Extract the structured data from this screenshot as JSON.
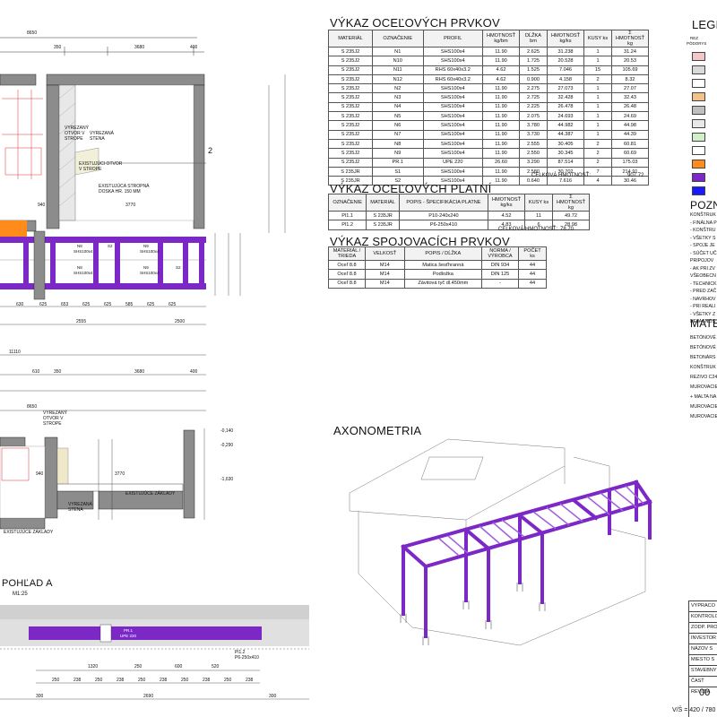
{
  "titles": {
    "steel_elements": "VÝKAZ OCEĽOVÝCH PRVKOV",
    "steel_plates": "VÝKAZ OCEĽOVÝCH PLATNÍ",
    "connectors": "VÝKAZ SPOJOVACÍCH PRVKOV",
    "axonometry": "AXONOMETRIA",
    "view_a": "POHĽAD A",
    "view_a_scale": "M1:25",
    "legend": "LEGE",
    "notes": "POZN",
    "materials": "MATE"
  },
  "steel_table": {
    "headers": [
      "MATERIÁL",
      "OZNAČENIE",
      "PROFIL",
      "HMOTNOSŤ kg/bm",
      "DĹŽKA bm",
      "HMOTNOSŤ kg/ks",
      "KUSY ks",
      "Σ HMOTNOSŤ kg"
    ],
    "rows": [
      [
        "S 235J2",
        "N1",
        "SHS100x4",
        "11.90",
        "2.625",
        "31.238",
        "1",
        "31.24"
      ],
      [
        "S 235J2",
        "N10",
        "SHS100x4",
        "11.90",
        "1.725",
        "20.528",
        "1",
        "20.53"
      ],
      [
        "S 235J2",
        "N11",
        "RHS 60x40x3.2",
        "4.62",
        "1.525",
        "7.046",
        "15",
        "105.69"
      ],
      [
        "S 235J2",
        "N12",
        "RHS 60x40x3.2",
        "4.62",
        "0.900",
        "4.158",
        "2",
        "8.32"
      ],
      [
        "S 235J2",
        "N2",
        "SHS100x4",
        "11.90",
        "2.275",
        "27.073",
        "1",
        "27.07"
      ],
      [
        "S 235J2",
        "N3",
        "SHS100x4",
        "11.90",
        "2.725",
        "32.428",
        "1",
        "32.43"
      ],
      [
        "S 235J2",
        "N4",
        "SHS100x4",
        "11.90",
        "2.225",
        "26.478",
        "1",
        "26.48"
      ],
      [
        "S 235J2",
        "N5",
        "SHS100x4",
        "11.90",
        "2.075",
        "24.693",
        "1",
        "24.69"
      ],
      [
        "S 235J2",
        "N6",
        "SHS100x4",
        "11.90",
        "3.780",
        "44.982",
        "1",
        "44.98"
      ],
      [
        "S 235J2",
        "N7",
        "SHS100x4",
        "11.90",
        "3.730",
        "44.387",
        "1",
        "44.39"
      ],
      [
        "S 235J2",
        "N8",
        "SHS100x4",
        "11.90",
        "2.555",
        "30.405",
        "2",
        "60.81"
      ],
      [
        "S 235J2",
        "N9",
        "SHS100x4",
        "11.90",
        "2.550",
        "30.345",
        "2",
        "60.69"
      ],
      [
        "S 235J2",
        "PR.1",
        "UPE 220",
        "26.60",
        "3.290",
        "87.514",
        "2",
        "175.03"
      ],
      [
        "S 235JR",
        "S1",
        "SHS100x4",
        "11.90",
        "2.580",
        "30.702",
        "7",
        "214.91"
      ],
      [
        "S 235JR",
        "S2",
        "SHS100x4",
        "11.90",
        "0.640",
        "7.616",
        "4",
        "30.46"
      ]
    ],
    "total_label": "CELKOVÁ HMOTNOSŤ:",
    "total_value": "907.72"
  },
  "plates_table": {
    "headers": [
      "OZNAČENIE",
      "MATERIÁL",
      "POPIS - ŠPECIFIKÁCIA PLATNE",
      "HMOTNOSŤ kg/ks",
      "KUSY ks",
      "Σ HMOTNOSŤ kg"
    ],
    "rows": [
      [
        "Pl1.1",
        "S 235JR",
        "P10-240x240",
        "4.52",
        "11",
        "49.72"
      ],
      [
        "Pl1.2",
        "S 235JR",
        "P6-250x410",
        "4.83",
        "6",
        "28.98"
      ]
    ],
    "total_label": "CELKOVÁ HMOTNOSŤ:",
    "total_value": "78.70"
  },
  "connectors_table": {
    "headers": [
      "MATERIÁL / TRIEDA",
      "VELKOSŤ",
      "POPIS / DĹŽKA",
      "NORMA / VÝROBCA",
      "POČET ks"
    ],
    "rows": [
      [
        "Oceľ 8.8",
        "M14",
        "Matica šesťhranná",
        "DIN 934",
        "44"
      ],
      [
        "Oceľ 8.8",
        "M14",
        "Podložka",
        "DIN 125",
        "44"
      ],
      [
        "Oceľ 8.8",
        "M14",
        "Závitová tyč dl.450mm",
        "-",
        "44"
      ]
    ]
  },
  "legend": {
    "col_headers": [
      "REZ",
      "PÔDORYS"
    ],
    "swatch_colors": [
      "#f4c6c6",
      "#d9d9d9",
      "#ffffff",
      "#f2c28a",
      "#bfbfbf",
      "#e8e8e8",
      "#d0f0c8",
      "#ffffff",
      "#ff8c1a",
      "#7b28c6",
      "#1a1aff"
    ]
  },
  "notes": {
    "items": [
      "KONŠTRUK",
      "- FINÁLNA P",
      "- KONŠTRU",
      "- VŠETKY S",
      "- SPOJE JE",
      "- SÚČET UČ",
      "PRIPOJOV",
      "- AK PRI ZV",
      "VŠEOBECN",
      "- TECHNICK",
      "- PRED ZAČ",
      "- NAVRHOV",
      "- PRI REALI",
      "- VŠETKY Z",
      "NEJASNOS"
    ]
  },
  "materials": {
    "items": [
      "BETÓNOVÉ",
      "BETÓNOVÉ",
      "BETONÁRS",
      "KONŠTRUK",
      "REZIVO C24",
      "MUROVACIE",
      "+ MALTA NA",
      "MUROVACIE",
      "MUROVACIE"
    ]
  },
  "title_block": {
    "rows": [
      "VYPRACO",
      "KONTROLO",
      "ZODP. PRO",
      "INVESTOR",
      "NÁZOV S",
      "MIESTO S",
      "STAVEBNY",
      "ČASŤ",
      "REVÍZIA"
    ],
    "revision": "00",
    "scale": "V/Š = 420 / 780"
  },
  "plan": {
    "dims_top": [
      "8650",
      "350",
      "3680",
      "400"
    ],
    "dims_mid": [
      "630",
      "625",
      "653",
      "625",
      "625",
      "585",
      "625",
      "625"
    ],
    "dims_low": [
      "2555",
      "2500",
      "50"
    ],
    "dim_11110": "11110",
    "dims_bottom": [
      "610",
      "350",
      "3680",
      "400"
    ],
    "dim_8650b": "8650",
    "beam_labels": [
      "N8",
      "SHS100x4",
      "N9",
      "SHS100x4",
      "S2",
      "N8",
      "SHS100x4",
      "N9",
      "SHS100x4",
      "S2",
      "N10",
      "SHS100x4"
    ],
    "notes": [
      "VYREZANÝ OTVOR V STROPE",
      "VYREZANÁ STENA",
      "EXISTUJÚCI OTVOR V STROPE",
      "EXISTUJÚCA STROPNÁ DOSKA HR. 150 MM"
    ],
    "dim_3770": "3770",
    "dim_940": "940",
    "section_mark": "2",
    "vert_dims": [
      "400",
      "1600",
      "3830",
      "4690",
      "1725",
      "1625",
      "400"
    ]
  },
  "section": {
    "labels": [
      "VYREZANÝ OTVOR V STROPE",
      "VYREZANÁ STENA",
      "EXISTUJÚCE ZÁKLADY",
      "EXISTUJÚCE ZÁKLADY"
    ],
    "dims": [
      "940",
      "3770",
      "1340",
      "1340",
      "720",
      "500",
      "720"
    ],
    "levels": [
      "-0,140",
      "-0,290",
      "-1,630"
    ]
  },
  "view_a": {
    "dims1": [
      "1320",
      "250",
      "600",
      "520"
    ],
    "dims2": [
      "250",
      "238",
      "250",
      "238",
      "250",
      "238",
      "250",
      "238",
      "250",
      "238",
      "250"
    ],
    "dims3": [
      "300",
      "2690",
      "300"
    ],
    "labels": [
      "PR.1",
      "UPE 220",
      "Pl1.2",
      "P6-250x410"
    ]
  }
}
